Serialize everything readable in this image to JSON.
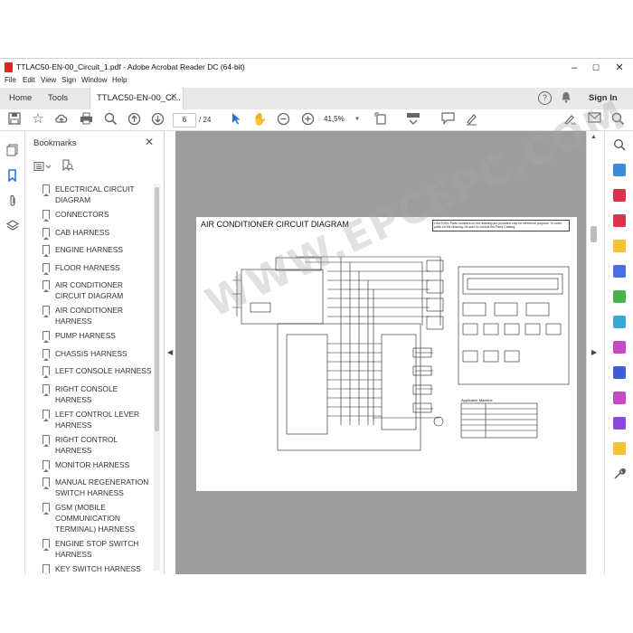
{
  "window": {
    "title": "TTLAC50-EN-00_Circuit_1.pdf - Adobe Acrobat Reader DC (64-bit)",
    "minimize": "–",
    "maximize": "☐",
    "close": "✕"
  },
  "menu": [
    "File",
    "Edit",
    "View",
    "Sign",
    "Window",
    "Help"
  ],
  "tabs": {
    "home": "Home",
    "tools": "Tools",
    "document": "TTLAC50-EN-00_Ci...",
    "close": "✕",
    "help_glyph": "?",
    "sign_in": "Sign In"
  },
  "toolbar": {
    "page_current": "6",
    "page_total": "/ 24",
    "zoom": "41,5%"
  },
  "bookmarks": {
    "title": "Bookmarks",
    "close": "✕",
    "items": [
      "ELECTRICAL CIRCUIT DIAGRAM",
      "CONNECTORS",
      "CAB HARNESS",
      "ENGINE HARNESS",
      "FLOOR HARNESS",
      "AIR CONDITIONER CIRCUIT DIAGRAM",
      "AIR CONDITIONER HARNESS",
      "PUMP HARNESS",
      "CHASSIS HARNESS",
      "LEFT CONSOLE HARNESS",
      "RIGHT CONSOLE HARNESS",
      "LEFT CONTROL LEVER HARNESS",
      "RIGHT CONTROL HARNESS",
      "MONITOR HARNESS",
      "MANUAL REGENERATION SWITCH HARNESS",
      "GSM (MOBILE COMMUNICATION TERMINAL) HARNESS",
      "ENGINE STOP SWITCH HARNESS",
      "KEY SWITCH HARNESS"
    ]
  },
  "document": {
    "diagram_title": "AIR CONDITIONER CIRCUIT DIAGRAM",
    "caution": "CAUTION: Parts numbers on the drawing are provided only for reference purpose. To order parts on the drawing, be sure to consult the Parts Catalog.",
    "applicable_heading": "Applicable Machine",
    "watermark": "WWW.EPCEPC.COM"
  },
  "colors": {
    "accent_blue": "#2d6fd1",
    "doc_background": "#9d9d9d",
    "acrobat_red": "#d9281c"
  }
}
